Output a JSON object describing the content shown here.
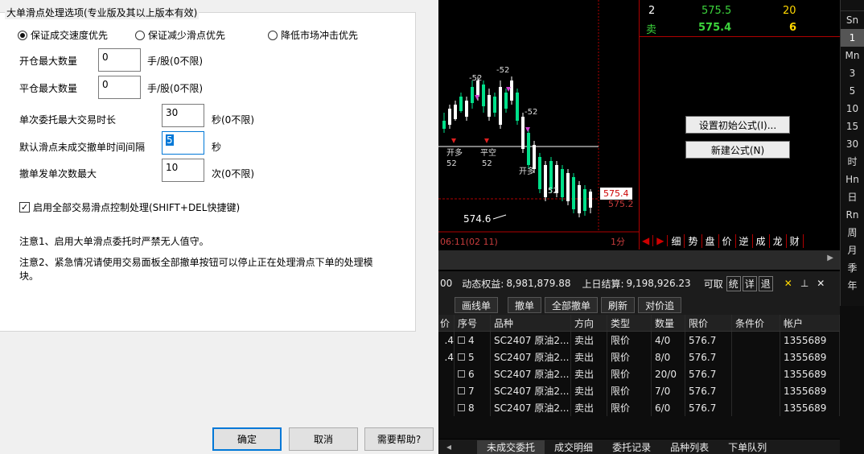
{
  "dialog": {
    "group_title": "大单滑点处理选项(专业版及其以上版本有效)",
    "radios": [
      {
        "label": "保证成交速度优先",
        "checked": true
      },
      {
        "label": "保证减少滑点优先",
        "checked": false
      },
      {
        "label": "降低市场冲击优先",
        "checked": false
      }
    ],
    "fields": [
      {
        "label": "开仓最大数量",
        "value": "0",
        "unit": "手/股(0不限)"
      },
      {
        "label": "平仓最大数量",
        "value": "0",
        "unit": "手/股(0不限)"
      },
      {
        "label": "单次委托最大交易时长",
        "value": "30",
        "unit": "秒(0不限)"
      },
      {
        "label": "默认滑点未成交撤单时间间隔",
        "value": "5",
        "unit": "秒"
      },
      {
        "label": "撤单发单次数最大",
        "value": "10",
        "unit": "次(0不限)"
      }
    ],
    "checkbox_label": "启用全部交易滑点控制处理(SHIFT+DEL快捷键)",
    "note1": "注意1、启用大单滑点委托时严禁无人值守。",
    "note2": "注意2、紧急情况请使用交易面板全部撤单按钮可以停止正在处理滑点下单的处理模块。",
    "ok": "确定",
    "cancel": "取消",
    "help": "需要帮助?"
  },
  "chart": {
    "labels": {
      "low": "574.6",
      "current": "575.4",
      "dashed": "575.2",
      "date": "06:11(02 11)",
      "period": "1分",
      "tag_52": "-52",
      "kd": "开多",
      "pk": "平空",
      "n52": "52"
    }
  },
  "quote": {
    "row1": {
      "level": "2",
      "price": "575.5",
      "vol": "20"
    },
    "row2": {
      "level": "卖",
      "price": "575.4",
      "vol": "6"
    }
  },
  "formula_buttons": {
    "set_init": "设置初始公式(I)...",
    "new": "新建公式(N)"
  },
  "indicator_tabs": [
    "细",
    "势",
    "盘",
    "价",
    "逆",
    "成",
    "龙",
    "财"
  ],
  "periods": [
    "Sn",
    "1",
    "Mn",
    "3",
    "5",
    "10",
    "15",
    "30",
    "时",
    "Hn",
    "日",
    "Rn",
    "周",
    "月",
    "季",
    "年"
  ],
  "account": {
    "prefix": "00",
    "dynamic_label": "动态权益:",
    "dynamic_value": "8,981,879.88",
    "settle_label": "上日结算:",
    "settle_value": "9,198,926.23",
    "avail_label": "可取",
    "btn_tong": "统",
    "btn_xiang": "详",
    "btn_tui": "退"
  },
  "toolbar": [
    "画线单",
    "撤单",
    "全部撤单",
    "刷新",
    "对价追"
  ],
  "table": {
    "headers": [
      "序号",
      "品种",
      "方向",
      "类型",
      "数量",
      "限价",
      "条件价",
      "帐户"
    ],
    "left_col_header": "价",
    "left_col_values": [
      ".4",
      ".4"
    ],
    "rows": [
      {
        "seq": "4",
        "symbol": "SC2407 原油2...",
        "dir": "卖出",
        "type": "限价",
        "qty": "4/0",
        "price": "576.7",
        "cond": "",
        "account": "1355689"
      },
      {
        "seq": "5",
        "symbol": "SC2407 原油2...",
        "dir": "卖出",
        "type": "限价",
        "qty": "8/0",
        "price": "576.7",
        "cond": "",
        "account": "1355689"
      },
      {
        "seq": "6",
        "symbol": "SC2407 原油2...",
        "dir": "卖出",
        "type": "限价",
        "qty": "20/0",
        "price": "576.7",
        "cond": "",
        "account": "1355689"
      },
      {
        "seq": "7",
        "symbol": "SC2407 原油2...",
        "dir": "卖出",
        "type": "限价",
        "qty": "7/0",
        "price": "576.7",
        "cond": "",
        "account": "1355689"
      },
      {
        "seq": "8",
        "symbol": "SC2407 原油2...",
        "dir": "卖出",
        "type": "限价",
        "qty": "6/0",
        "price": "576.7",
        "cond": "",
        "account": "1355689"
      }
    ]
  },
  "bottom_tabs": [
    "未成交委托",
    "成交明细",
    "委托记录",
    "品种列表",
    "下单队列"
  ],
  "colors": {
    "green": "#3cd33c",
    "yellow": "#ffd800",
    "red": "#c80000"
  }
}
